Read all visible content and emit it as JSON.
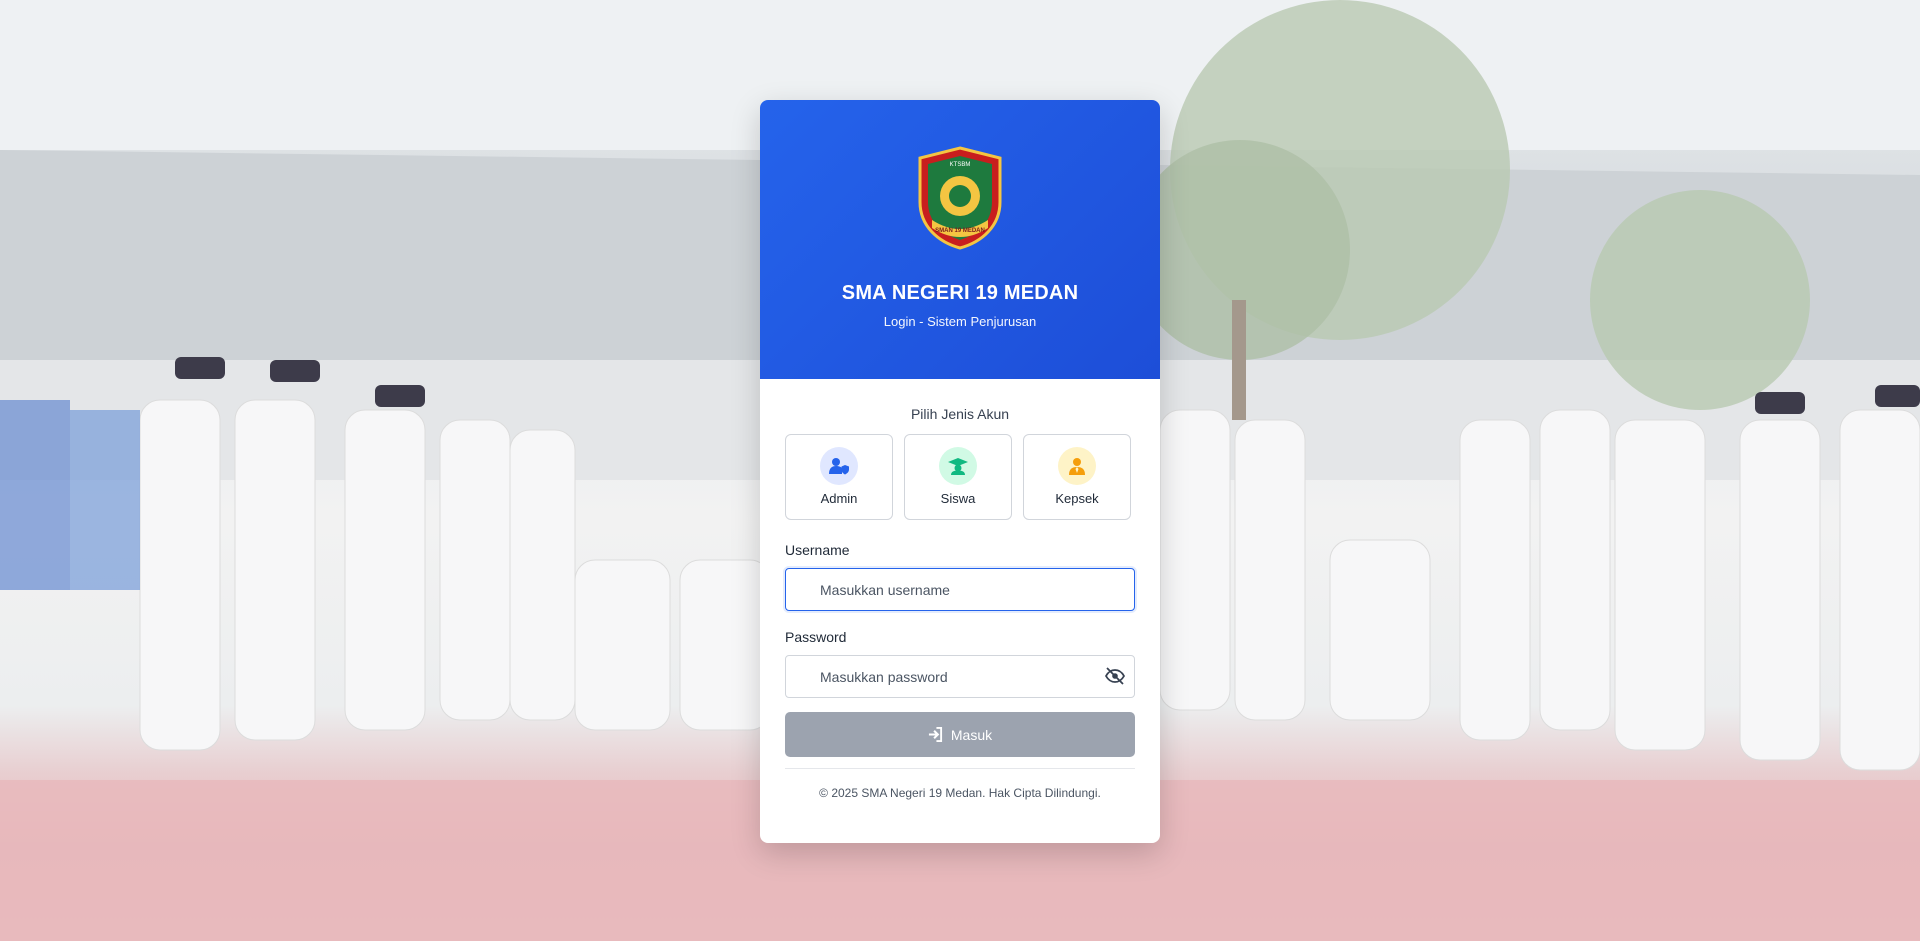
{
  "header": {
    "school_name": "SMA NEGERI 19 MEDAN",
    "subtitle": "Login - Sistem Penjurusan",
    "logo_text_top": "KTSBM",
    "logo_text_bottom": "SMAN 19 MEDAN"
  },
  "account": {
    "label": "Pilih Jenis Akun",
    "roles": [
      {
        "label": "Admin",
        "icon": "user-shield-icon",
        "color": "#2563eb",
        "bg": "#e0e7ff"
      },
      {
        "label": "Siswa",
        "icon": "graduation-cap-icon",
        "color": "#10b981",
        "bg": "#d1fae5"
      },
      {
        "label": "Kepsek",
        "icon": "user-tie-icon",
        "color": "#f59e0b",
        "bg": "#fef3c7"
      }
    ]
  },
  "form": {
    "username_label": "Username",
    "username_placeholder": "Masukkan username",
    "password_label": "Password",
    "password_placeholder": "Masukkan password",
    "submit_label": "Masuk",
    "submit_icon": "sign-in-icon",
    "toggle_icon": "eye-slash-icon"
  },
  "footer": {
    "text": "© 2025 SMA Negeri 19 Medan. Hak Cipta Dilindungi."
  },
  "colors": {
    "primary": "#2563eb",
    "button_disabled": "#9ca3af"
  }
}
